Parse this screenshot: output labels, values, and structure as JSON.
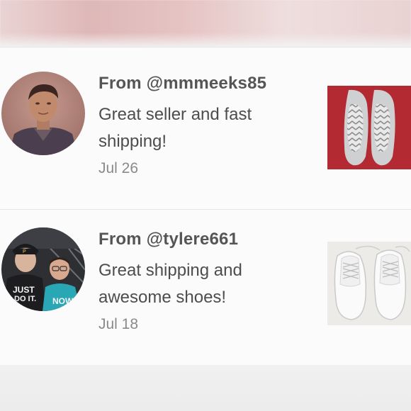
{
  "reviews": [
    {
      "from": "From @mmmeeks85",
      "comment": "Great seller and fast shipping!",
      "date": "Jul 26",
      "avatar_icon": "user-avatar-photo",
      "product_icon": "silver-flats-photo"
    },
    {
      "from": "From @tylere661",
      "comment": "Great shipping and awesome shoes!",
      "date": "Jul 18",
      "avatar_icon": "user-avatar-photo",
      "product_icon": "white-sneakers-photo"
    }
  ],
  "colors": {
    "text_primary": "#555555",
    "text_secondary": "#8a8a8a",
    "card_background": "#fbfbfb",
    "divider": "#e6e6e6"
  }
}
